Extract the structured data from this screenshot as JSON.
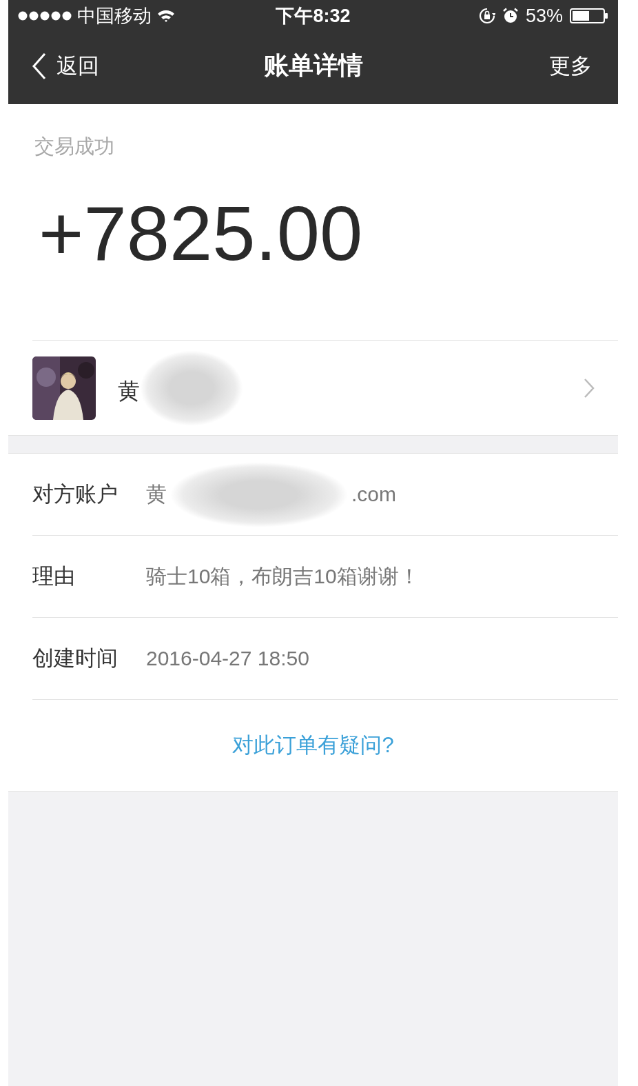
{
  "status_bar": {
    "carrier": "中国移动",
    "time": "下午8:32",
    "battery": "53%"
  },
  "nav": {
    "back": "返回",
    "title": "账单详情",
    "more": "更多"
  },
  "status": "交易成功",
  "amount": "+7825.00",
  "contact": {
    "name": "黄",
    "redacted": true
  },
  "details": [
    {
      "kind": "redacted",
      "label": "对方账户",
      "visible_start": "黄",
      "visible_end": ".com"
    },
    {
      "kind": "text",
      "label": "理由",
      "value": "骑士10箱，布朗吉10箱谢谢！"
    },
    {
      "kind": "text",
      "label": "创建时间",
      "value": "2016-04-27 18:50"
    }
  ],
  "question_link": "对此订单有疑问?"
}
